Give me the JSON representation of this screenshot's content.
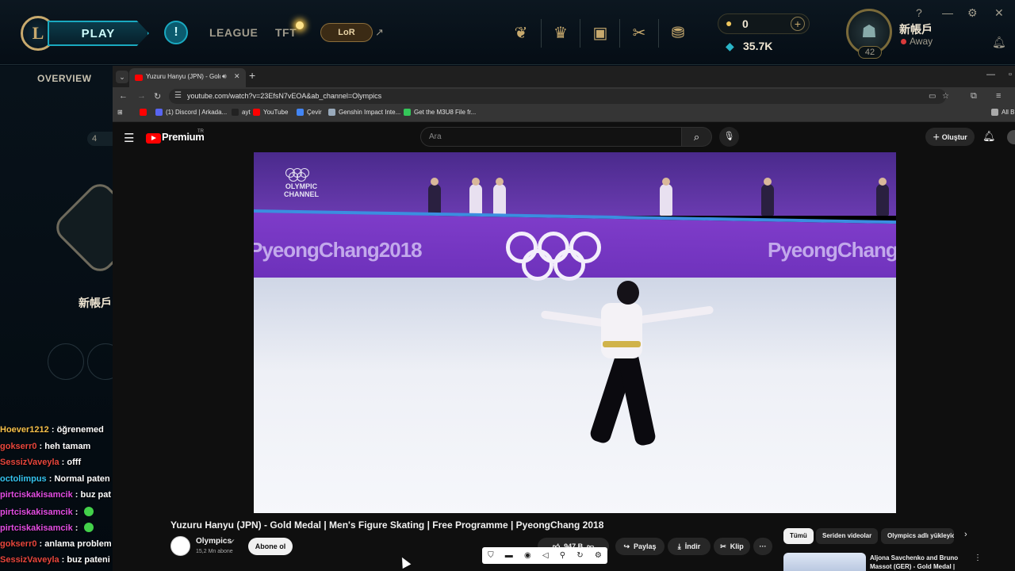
{
  "league": {
    "logo": "L",
    "play_label": "PLAY",
    "alert_icon": "!",
    "nav": [
      "LEAGUE",
      "TFT"
    ],
    "lor_label": "LoR",
    "external_icon": "↗",
    "icons": [
      "champions-icon",
      "rewards-icon",
      "collection-icon",
      "crafting-icon",
      "store-icon"
    ],
    "rp_value": "0",
    "be_value": "35.7K",
    "add_icon": "+",
    "username": "新帳戶",
    "status": "Away",
    "level": "42",
    "help_icon": "?",
    "minimize_icon": "—",
    "settings_icon": "⚙",
    "close_icon": "✕",
    "overview_label": "OVERVIEW",
    "pill_text": "4",
    "left_name": "新帳戶",
    "colors": {
      "gold": "#c8aa6e",
      "teal": "#1aa9c0",
      "status_away": "#d93a3a"
    }
  },
  "chat": [
    {
      "user": "Hoever1212",
      "color": "#f5c04a",
      "text": "öğrenemed",
      "emoji": false
    },
    {
      "user": "gokserr0",
      "color": "#e8463c",
      "text": "heh tamam",
      "emoji": false
    },
    {
      "user": "SessizVaveyla",
      "color": "#e8463c",
      "text": "offf",
      "emoji": false
    },
    {
      "user": "octolimpus",
      "color": "#35c4f0",
      "text": "Normal paten",
      "emoji": false
    },
    {
      "user": "pirtciskakisamcik",
      "color": "#e34de3",
      "text": "buz pat",
      "emoji": false
    },
    {
      "user": "pirtciskakisamcik",
      "color": "#e34de3",
      "text": "",
      "emoji": true
    },
    {
      "user": "pirtciskakisamcik",
      "color": "#e34de3",
      "text": "",
      "emoji": true
    },
    {
      "user": "gokserr0",
      "color": "#e8463c",
      "text": "anlama problem",
      "emoji": false
    },
    {
      "user": "SessizVaveyla",
      "color": "#e8463c",
      "text": "buz pateni",
      "emoji": false
    }
  ],
  "browser": {
    "tab_title": "Yuzuru Hanyu (JPN) - Gold",
    "new_tab": "+",
    "url": "youtube.com/watch?v=23EfsN7vEOA&ab_channel=Olympics",
    "bookmarks": [
      {
        "label": "",
        "color": "#ff0000"
      },
      {
        "label": "(1) Discord | Arkada...",
        "color": "#5865f2"
      },
      {
        "label": "ayt",
        "color": "#222222"
      },
      {
        "label": "YouTube",
        "color": "#ff0000"
      },
      {
        "label": "Çevir",
        "color": "#4285f4"
      },
      {
        "label": "Genshin Impact Inte...",
        "color": "#9ab"
      },
      {
        "label": "Get the M3U8 File fr...",
        "color": "#34c759"
      }
    ],
    "all_bookmarks": "All B"
  },
  "youtube": {
    "logo_text": "Premium",
    "logo_sup": "TR",
    "search_placeholder": "Ara",
    "create_label": "Oluştur",
    "video": {
      "channel_watermark_line1": "OLYMPIC",
      "channel_watermark_line2": "CHANNEL",
      "board_text_left": "PyeongChang2018",
      "board_text_right": "PyeongChang"
    },
    "title": "Yuzuru Hanyu (JPN) - Gold Medal | Men's Figure Skating | Free Programme | PyeongChang 2018",
    "channel_name": "Olympics",
    "subscribers": "15,2 Mn abone",
    "subscribe_label": "Abone ol",
    "likes": "947 B",
    "share_label": "Paylaş",
    "download_label": "İndir",
    "clip_label": "Klip",
    "more_label": "···",
    "chips": [
      "Tümü",
      "Seriden videolar",
      "Olympics adlı yükleyici"
    ],
    "rec_title": "Aljona Savchenko and Bruno Massot (GER) - Gold Medal |"
  }
}
